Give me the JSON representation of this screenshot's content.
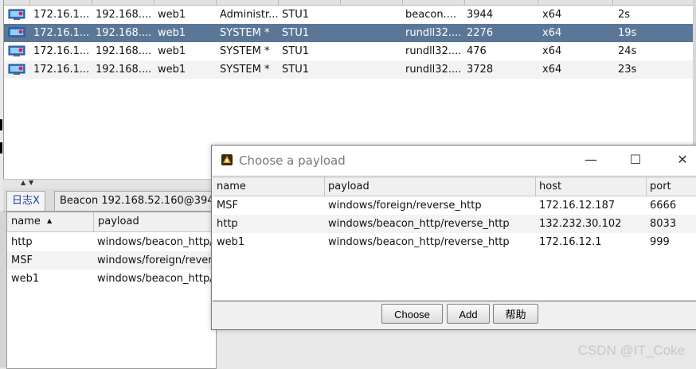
{
  "beacons": {
    "rows": [
      {
        "external": "172.16.1...",
        "internal": "192.168....",
        "listener": "web1",
        "user": "Administr...",
        "computer": "STU1",
        "process": "beacon....",
        "pid": "3944",
        "arch": "x64",
        "last": "2s",
        "selected": false
      },
      {
        "external": "172.16.1...",
        "internal": "192.168....",
        "listener": "web1",
        "user": "SYSTEM *",
        "computer": "STU1",
        "process": "rundll32....",
        "pid": "2276",
        "arch": "x64",
        "last": "19s",
        "selected": true
      },
      {
        "external": "172.16.1...",
        "internal": "192.168....",
        "listener": "web1",
        "user": "SYSTEM *",
        "computer": "STU1",
        "process": "rundll32....",
        "pid": "476",
        "arch": "x64",
        "last": "24s",
        "selected": false
      },
      {
        "external": "172.16.1...",
        "internal": "192.168....",
        "listener": "web1",
        "user": "SYSTEM *",
        "computer": "STU1",
        "process": "rundll32....",
        "pid": "3728",
        "arch": "x64",
        "last": "23s",
        "selected": false
      }
    ]
  },
  "splitter": {
    "up": "▲",
    "down": "▼"
  },
  "tabs": [
    {
      "label": "日志X"
    },
    {
      "label": "Beacon 192.168.52.160@394"
    }
  ],
  "listeners": {
    "headers": {
      "name": "name",
      "sort": "▲",
      "payload": "payload"
    },
    "rows": [
      {
        "name": "http",
        "payload": "windows/beacon_http/r"
      },
      {
        "name": "MSF",
        "payload": "windows/foreign/revers"
      },
      {
        "name": "web1",
        "payload": "windows/beacon_http/r"
      }
    ]
  },
  "dialog": {
    "title": "Choose a payload",
    "controls": {
      "minimize": "—",
      "maximize": "☐",
      "close": "✕"
    },
    "headers": {
      "name": "name",
      "payload": "payload",
      "host": "host",
      "port": "port"
    },
    "rows": [
      {
        "name": "MSF",
        "payload": "windows/foreign/reverse_http",
        "host": "172.16.12.187",
        "port": "6666"
      },
      {
        "name": "http",
        "payload": "windows/beacon_http/reverse_http",
        "host": "132.232.30.102",
        "port": "8033"
      },
      {
        "name": "web1",
        "payload": "windows/beacon_http/reverse_http",
        "host": "172.16.12.1",
        "port": "999"
      }
    ],
    "buttons": {
      "choose": "Choose",
      "add": "Add",
      "help": "帮助"
    }
  },
  "watermark": "CSDN @IT_Coke",
  "colors": {
    "selection": "#5a7797",
    "tab_active_text": "#1a3f9c"
  }
}
